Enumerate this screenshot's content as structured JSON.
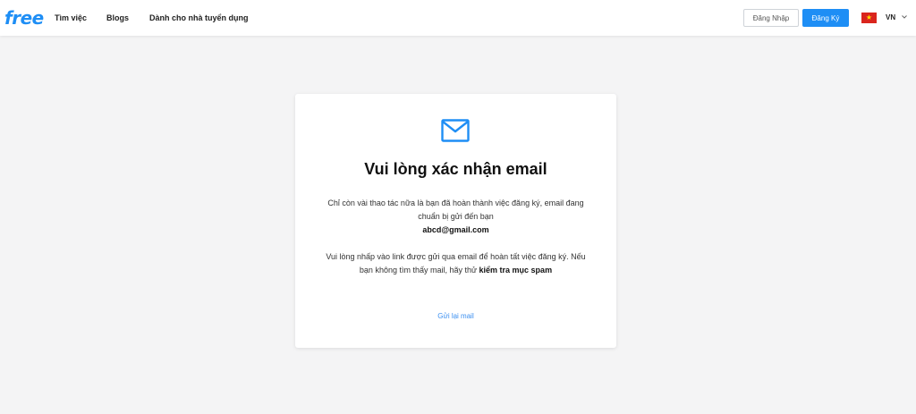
{
  "header": {
    "logo_text": "free",
    "nav": [
      "Tìm việc",
      "Blogs",
      "Dành cho nhà tuyển dụng"
    ],
    "login_label": "Đăng Nhập",
    "register_label": "Đăng Ký",
    "language": "VN",
    "flag_icon": "vietnam-flag-icon"
  },
  "card": {
    "icon": "envelope-icon",
    "title": "Vui lòng xác nhận email",
    "message_1": "Chỉ còn vài thao tác nữa là bạn đã hoàn thành việc đăng ký, email đang chuẩn bị gửi đến bạn",
    "email": "abcd@gmail.com",
    "message_2": "Vui lòng nhấp vào link được gửi qua email để hoàn tất việc đăng ký. Nếu bạn không tìm thấy mail, hãy thử",
    "spam_hint": "kiểm tra mục spam",
    "resend_label": "Gửi lại mail"
  },
  "colors": {
    "brand": "#1e8ef5",
    "background": "#f4f4f5",
    "link": "#3b8ff0"
  }
}
